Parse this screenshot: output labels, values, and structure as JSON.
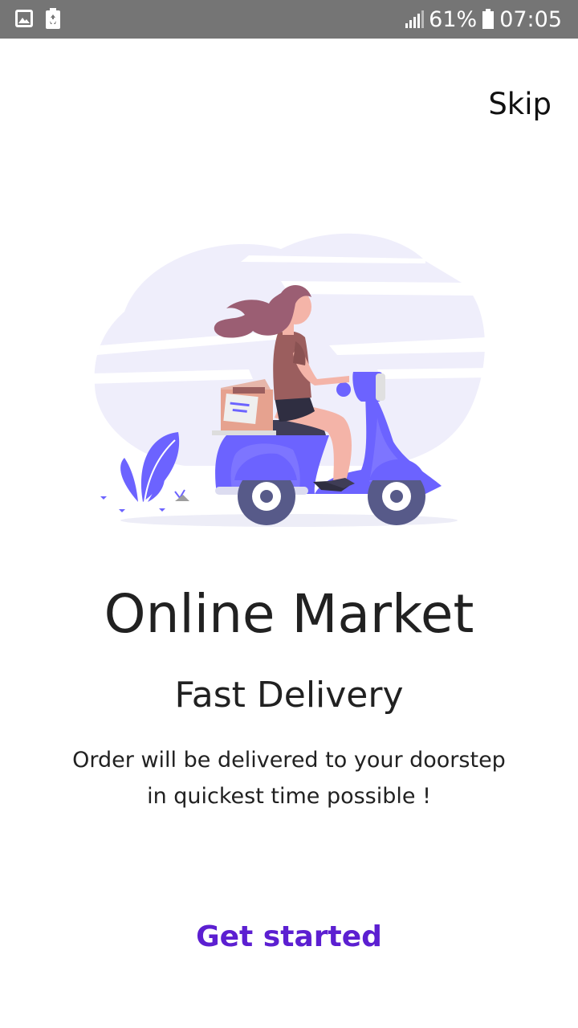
{
  "status_bar": {
    "left_icons": [
      "gallery-icon",
      "battery-saver-icon"
    ],
    "battery_percent": "61%",
    "time": "07:05"
  },
  "onboarding": {
    "skip_label": "Skip",
    "title": "Online Market",
    "subtitle": "Fast Delivery",
    "description_line1": "Order will be delivered to your doorstep",
    "description_line2": "in quickest time possible !",
    "cta_label": "Get started"
  },
  "colors": {
    "status_bar": "#757575",
    "accent": "#5c1fd1",
    "illustration_primary": "#6c63ff",
    "illustration_background": "#efeefb",
    "text": "#212121"
  }
}
